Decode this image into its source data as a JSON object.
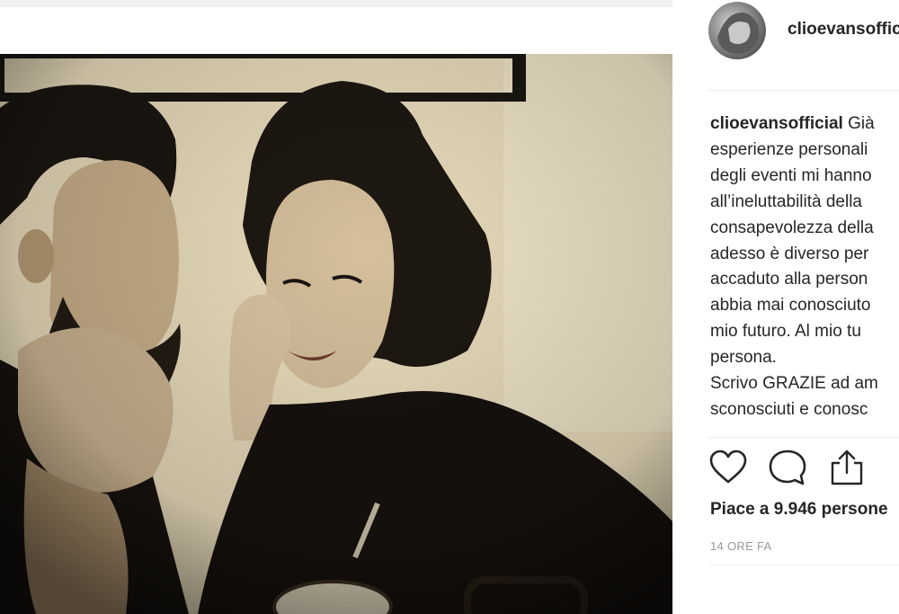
{
  "post": {
    "username": "clioevansofficial",
    "caption_lines": [
      "esperienze personali",
      "degli eventi mi hanno",
      "all’ineluttabilità della",
      "consapevolezza della",
      "adesso è diverso per",
      "accaduto alla person",
      "abbia mai conosciuto",
      "mio futuro. Al mio tu",
      "persona.",
      "Scrivo GRAZIE ad am",
      "sconosciuti e conosc"
    ],
    "caption_first_word": "Già",
    "likes_text": "Piace a 9.946 persone",
    "time_ago": "14 ORE FA"
  },
  "icons": {
    "like": "heart-icon",
    "comment": "comment-icon",
    "share": "share-icon"
  }
}
